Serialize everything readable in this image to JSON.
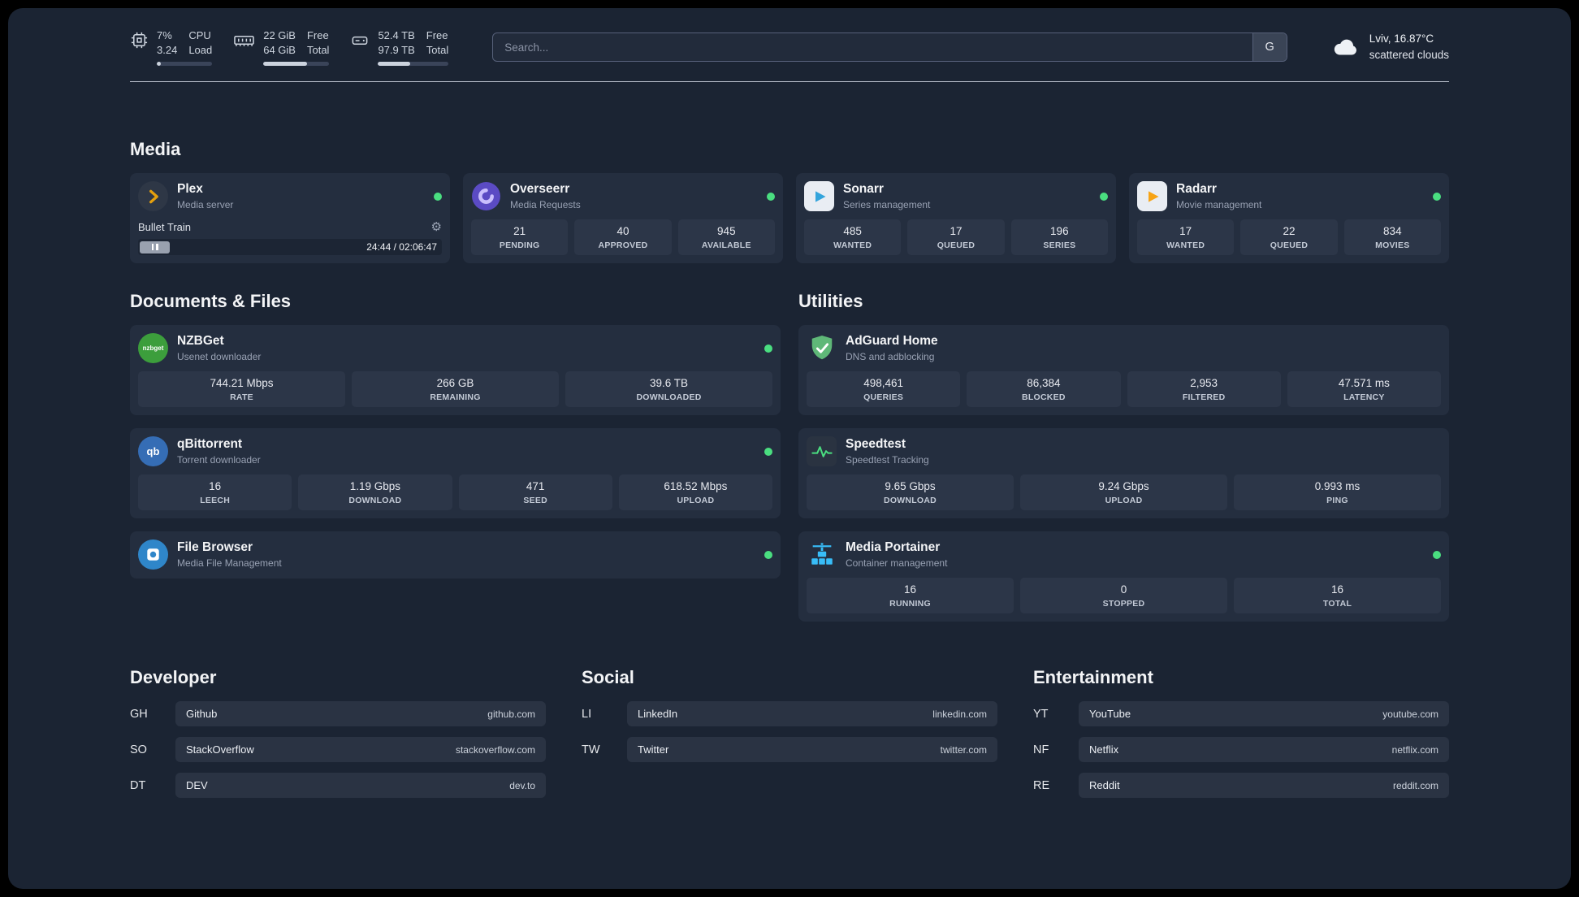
{
  "topbar": {
    "cpu": {
      "pct": "7%",
      "load": "3.24",
      "label1": "CPU",
      "label2": "Load",
      "progress": 7
    },
    "memory": {
      "free": "22 GiB",
      "total": "64 GiB",
      "label1": "Free",
      "label2": "Total",
      "progress": 66
    },
    "disk": {
      "free": "52.4 TB",
      "total": "97.9 TB",
      "label1": "Free",
      "label2": "Total",
      "progress": 46
    },
    "search": {
      "placeholder": "Search...",
      "button_label": "G"
    },
    "weather": {
      "location": "Lviv, 16.87°C",
      "condition": "scattered clouds"
    }
  },
  "media": {
    "heading": "Media",
    "plex": {
      "title": "Plex",
      "subtitle": "Media server",
      "now_playing": "Bullet Train",
      "time": "24:44 / 02:06:47",
      "progress": 19
    },
    "overseerr": {
      "title": "Overseerr",
      "subtitle": "Media Requests",
      "stats": [
        {
          "value": "21",
          "label": "PENDING"
        },
        {
          "value": "40",
          "label": "APPROVED"
        },
        {
          "value": "945",
          "label": "AVAILABLE"
        }
      ]
    },
    "sonarr": {
      "title": "Sonarr",
      "subtitle": "Series management",
      "stats": [
        {
          "value": "485",
          "label": "WANTED"
        },
        {
          "value": "17",
          "label": "QUEUED"
        },
        {
          "value": "196",
          "label": "SERIES"
        }
      ]
    },
    "radarr": {
      "title": "Radarr",
      "subtitle": "Movie management",
      "stats": [
        {
          "value": "17",
          "label": "WANTED"
        },
        {
          "value": "22",
          "label": "QUEUED"
        },
        {
          "value": "834",
          "label": "MOVIES"
        }
      ]
    }
  },
  "documents": {
    "heading": "Documents & Files",
    "nzbget": {
      "title": "NZBGet",
      "subtitle": "Usenet downloader",
      "icon_label": "nzbget",
      "stats": [
        {
          "value": "744.21 Mbps",
          "label": "RATE"
        },
        {
          "value": "266 GB",
          "label": "REMAINING"
        },
        {
          "value": "39.6 TB",
          "label": "DOWNLOADED"
        }
      ]
    },
    "qbittorrent": {
      "title": "qBittorrent",
      "subtitle": "Torrent downloader",
      "icon_label": "qb",
      "stats": [
        {
          "value": "16",
          "label": "LEECH"
        },
        {
          "value": "1.19 Gbps",
          "label": "DOWNLOAD"
        },
        {
          "value": "471",
          "label": "SEED"
        },
        {
          "value": "618.52 Mbps",
          "label": "UPLOAD"
        }
      ]
    },
    "filebrowser": {
      "title": "File Browser",
      "subtitle": "Media File Management"
    }
  },
  "utilities": {
    "heading": "Utilities",
    "adguard": {
      "title": "AdGuard Home",
      "subtitle": "DNS and adblocking",
      "stats": [
        {
          "value": "498,461",
          "label": "QUERIES"
        },
        {
          "value": "86,384",
          "label": "BLOCKED"
        },
        {
          "value": "2,953",
          "label": "FILTERED"
        },
        {
          "value": "47.571 ms",
          "label": "LATENCY"
        }
      ]
    },
    "speedtest": {
      "title": "Speedtest",
      "subtitle": "Speedtest Tracking",
      "stats": [
        {
          "value": "9.65 Gbps",
          "label": "DOWNLOAD"
        },
        {
          "value": "9.24 Gbps",
          "label": "UPLOAD"
        },
        {
          "value": "0.993 ms",
          "label": "PING"
        }
      ]
    },
    "portainer": {
      "title": "Media Portainer",
      "subtitle": "Container management",
      "stats": [
        {
          "value": "16",
          "label": "RUNNING"
        },
        {
          "value": "0",
          "label": "STOPPED"
        },
        {
          "value": "16",
          "label": "TOTAL"
        }
      ]
    }
  },
  "bookmarks": {
    "developer": {
      "heading": "Developer",
      "items": [
        {
          "abbr": "GH",
          "name": "Github",
          "url": "github.com"
        },
        {
          "abbr": "SO",
          "name": "StackOverflow",
          "url": "stackoverflow.com"
        },
        {
          "abbr": "DT",
          "name": "DEV",
          "url": "dev.to"
        }
      ]
    },
    "social": {
      "heading": "Social",
      "items": [
        {
          "abbr": "LI",
          "name": "LinkedIn",
          "url": "linkedin.com"
        },
        {
          "abbr": "TW",
          "name": "Twitter",
          "url": "twitter.com"
        }
      ]
    },
    "entertainment": {
      "heading": "Entertainment",
      "items": [
        {
          "abbr": "YT",
          "name": "YouTube",
          "url": "youtube.com"
        },
        {
          "abbr": "NF",
          "name": "Netflix",
          "url": "netflix.com"
        },
        {
          "abbr": "RE",
          "name": "Reddit",
          "url": "reddit.com"
        }
      ]
    }
  },
  "colors": {
    "status_online": "#4ade80",
    "plex_gold": "#e5a00d",
    "sonarr_blue": "#33a4dc",
    "radarr_orange": "#f7a416",
    "nzbget_green": "#3c9e3c",
    "qbittorrent_blue": "#356db5",
    "adguard_green": "#5fb878",
    "portainer_blue": "#38bdf8"
  }
}
